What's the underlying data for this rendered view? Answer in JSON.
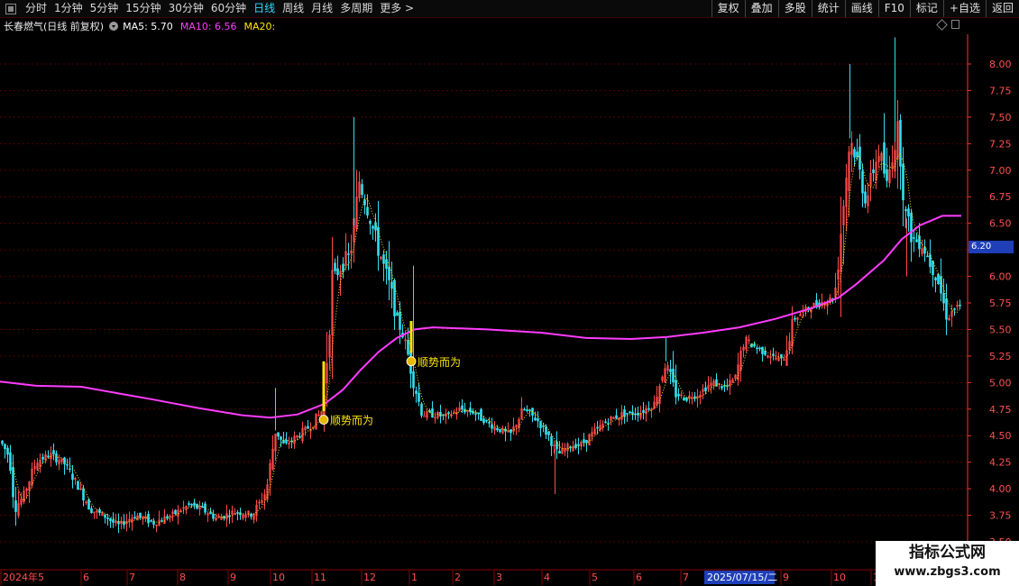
{
  "toolbar": {
    "tabs": [
      {
        "label": "分时",
        "active": false
      },
      {
        "label": "1分钟",
        "active": false
      },
      {
        "label": "5分钟",
        "active": false
      },
      {
        "label": "15分钟",
        "active": false
      },
      {
        "label": "30分钟",
        "active": false
      },
      {
        "label": "60分钟",
        "active": false
      },
      {
        "label": "日线",
        "active": true
      },
      {
        "label": "周线",
        "active": false
      },
      {
        "label": "月线",
        "active": false
      },
      {
        "label": "多周期",
        "active": false
      },
      {
        "label": "更多 >",
        "active": false
      }
    ],
    "right_buttons": [
      "复权",
      "叠加",
      "多股",
      "统计",
      "画线",
      "F10",
      "标记",
      "+自选",
      "返回"
    ]
  },
  "title": {
    "stock": "长春燃气(日线 前复权)",
    "ma5": "MA5: 5.70",
    "ma10": "MA10: 6.56",
    "ma20": "MA20:"
  },
  "price_axis": {
    "ticks": [
      "8.00",
      "7.75",
      "7.50",
      "7.25",
      "7.00",
      "6.75",
      "6.50",
      "6.25",
      "6.00",
      "5.75",
      "5.50",
      "5.25",
      "5.00",
      "4.75",
      "4.50",
      "4.25",
      "4.00",
      "3.75",
      "3.50"
    ],
    "current_price": "6.20"
  },
  "date_axis": {
    "labels": [
      {
        "text": "2024年5",
        "x_index": 0
      },
      {
        "text": "6",
        "x_index": 1
      },
      {
        "text": "7",
        "x_index": 2
      },
      {
        "text": "8",
        "x_index": 3
      },
      {
        "text": "9",
        "x_index": 4
      },
      {
        "text": "10",
        "x_index": 5
      },
      {
        "text": "11",
        "x_index": 6
      },
      {
        "text": "12",
        "x_index": 7
      },
      {
        "text": "1",
        "x_index": 8
      },
      {
        "text": "2",
        "x_index": 9
      },
      {
        "text": "3",
        "x_index": 10
      },
      {
        "text": "4",
        "x_index": 11
      },
      {
        "text": "5",
        "x_index": 12
      },
      {
        "text": "6",
        "x_index": 13
      },
      {
        "text": "7",
        "x_index": 14
      },
      {
        "text": "9",
        "x_index": 15
      },
      {
        "text": "10",
        "x_index": 16
      },
      {
        "text": "1",
        "x_index": 17
      }
    ],
    "cursor_date": "2025/07/15/二"
  },
  "signals": [
    {
      "label": "顺势而为",
      "price": 4.65
    },
    {
      "label": "顺势而为",
      "price": 5.2
    }
  ],
  "watermark": {
    "line1": "指标公式网",
    "line2": "www.zbgs3.com"
  },
  "colors": {
    "up": "#ff4a4a",
    "down": "#33e0f0",
    "ma_long": "#ff3cff",
    "ma_short": "#ffe600",
    "grid": "#550000",
    "axis": "#ff3030"
  },
  "chart_data": {
    "type": "candlestick",
    "ylim": [
      3.5,
      8.2
    ],
    "ma_long_line": [
      [
        0,
        5.01
      ],
      [
        40,
        4.97
      ],
      [
        90,
        4.96
      ],
      [
        130,
        4.9
      ],
      [
        170,
        4.84
      ],
      [
        220,
        4.76
      ],
      [
        270,
        4.69
      ],
      [
        300,
        4.67
      ],
      [
        330,
        4.7
      ],
      [
        360,
        4.8
      ],
      [
        380,
        4.93
      ],
      [
        400,
        5.12
      ],
      [
        420,
        5.29
      ],
      [
        440,
        5.42
      ],
      [
        460,
        5.5
      ],
      [
        480,
        5.52
      ],
      [
        540,
        5.5
      ],
      [
        600,
        5.47
      ],
      [
        650,
        5.42
      ],
      [
        700,
        5.41
      ],
      [
        740,
        5.43
      ],
      [
        780,
        5.47
      ],
      [
        820,
        5.52
      ],
      [
        860,
        5.6
      ],
      [
        900,
        5.7
      ],
      [
        930,
        5.8
      ],
      [
        950,
        5.93
      ],
      [
        980,
        6.15
      ],
      [
        1000,
        6.35
      ],
      [
        1020,
        6.48
      ],
      [
        1045,
        6.57
      ],
      [
        1066,
        6.57
      ]
    ],
    "price_path": [
      [
        0,
        4.45
      ],
      [
        10,
        4.3
      ],
      [
        16,
        3.82
      ],
      [
        25,
        3.92
      ],
      [
        40,
        4.26
      ],
      [
        55,
        4.32
      ],
      [
        70,
        4.25
      ],
      [
        85,
        4.05
      ],
      [
        100,
        3.8
      ],
      [
        115,
        3.75
      ],
      [
        130,
        3.65
      ],
      [
        150,
        3.75
      ],
      [
        170,
        3.68
      ],
      [
        190,
        3.75
      ],
      [
        210,
        3.85
      ],
      [
        225,
        3.8
      ],
      [
        240,
        3.72
      ],
      [
        260,
        3.78
      ],
      [
        280,
        3.76
      ],
      [
        295,
        3.98
      ],
      [
        305,
        4.55
      ],
      [
        315,
        4.4
      ],
      [
        330,
        4.5
      ],
      [
        345,
        4.6
      ],
      [
        358,
        4.75
      ],
      [
        368,
        5.95
      ],
      [
        378,
        6.1
      ],
      [
        388,
        6.2
      ],
      [
        398,
        6.9
      ],
      [
        408,
        6.6
      ],
      [
        418,
        6.3
      ],
      [
        430,
        5.95
      ],
      [
        440,
        5.6
      ],
      [
        450,
        5.35
      ],
      [
        458,
        5.0
      ],
      [
        468,
        4.7
      ],
      [
        480,
        4.7
      ],
      [
        495,
        4.68
      ],
      [
        510,
        4.75
      ],
      [
        525,
        4.72
      ],
      [
        540,
        4.62
      ],
      [
        555,
        4.55
      ],
      [
        565,
        4.5
      ],
      [
        580,
        4.75
      ],
      [
        595,
        4.65
      ],
      [
        608,
        4.5
      ],
      [
        618,
        4.32
      ],
      [
        630,
        4.4
      ],
      [
        645,
        4.42
      ],
      [
        660,
        4.55
      ],
      [
        675,
        4.65
      ],
      [
        690,
        4.7
      ],
      [
        710,
        4.72
      ],
      [
        725,
        4.8
      ],
      [
        738,
        5.2
      ],
      [
        748,
        4.9
      ],
      [
        760,
        4.85
      ],
      [
        775,
        4.9
      ],
      [
        790,
        5.0
      ],
      [
        805,
        4.95
      ],
      [
        815,
        5.05
      ],
      [
        825,
        5.4
      ],
      [
        840,
        5.32
      ],
      [
        855,
        5.25
      ],
      [
        868,
        5.2
      ],
      [
        880,
        5.6
      ],
      [
        895,
        5.7
      ],
      [
        910,
        5.75
      ],
      [
        925,
        5.8
      ],
      [
        935,
        6.7
      ],
      [
        942,
        7.3
      ],
      [
        950,
        7.1
      ],
      [
        960,
        6.7
      ],
      [
        968,
        7.0
      ],
      [
        975,
        7.2
      ],
      [
        983,
        6.85
      ],
      [
        990,
        7.2
      ],
      [
        996,
        7.4
      ],
      [
        1003,
        6.6
      ],
      [
        1012,
        6.35
      ],
      [
        1022,
        6.3
      ],
      [
        1030,
        6.15
      ],
      [
        1040,
        5.95
      ],
      [
        1050,
        5.6
      ],
      [
        1058,
        5.7
      ],
      [
        1066,
        5.72
      ]
    ]
  }
}
